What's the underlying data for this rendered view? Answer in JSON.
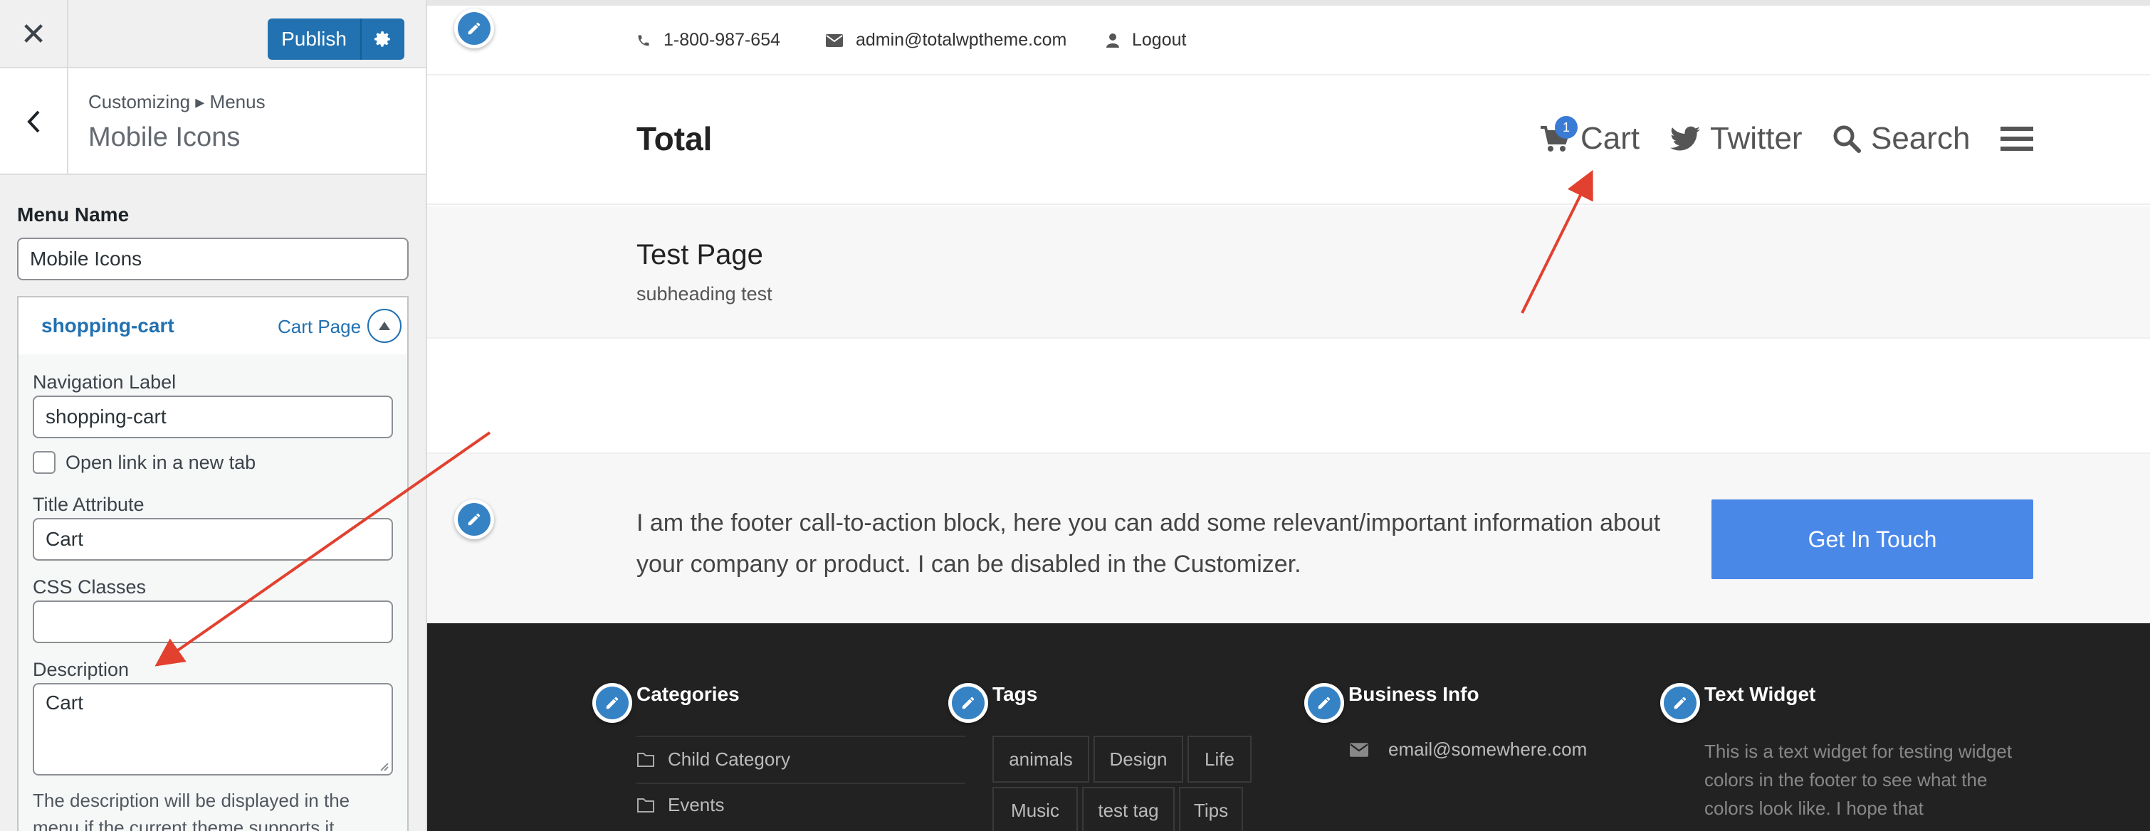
{
  "sidebar": {
    "close_label": "✕",
    "publish_label": "Publish",
    "breadcrumb": "Customizing ▸ Menus",
    "panel_title": "Mobile Icons",
    "menu_name_label": "Menu Name",
    "menu_name_value": "Mobile Icons",
    "item": {
      "title": "shopping-cart",
      "type": "Cart Page",
      "nav_label_label": "Navigation Label",
      "nav_label_value": "shopping-cart",
      "new_tab_label": "Open link in a new tab",
      "title_attr_label": "Title Attribute",
      "title_attr_value": "Cart",
      "css_classes_label": "CSS Classes",
      "css_classes_value": "",
      "description_label": "Description",
      "description_value": "Cart",
      "description_help": "The description will be displayed in the menu if the current theme supports it."
    }
  },
  "preview": {
    "topbar": {
      "phone": "1-800-987-654",
      "email": "admin@totalwptheme.com",
      "logout": "Logout"
    },
    "header": {
      "logo": "Total",
      "nav": [
        {
          "label": "Cart",
          "icon": "cart-icon",
          "badge": "1"
        },
        {
          "label": "Twitter",
          "icon": "twitter-icon"
        },
        {
          "label": "Search",
          "icon": "search-icon"
        }
      ]
    },
    "page_header": {
      "title": "Test Page",
      "subheading": "subheading test"
    },
    "cta": {
      "text": "I am the footer call-to-action block, here you can add some relevant/important information about your company or product. I can be disabled in the Customizer.",
      "button": "Get In Touch"
    },
    "footer": {
      "categories_title": "Categories",
      "categories": [
        "Child Category",
        "Events"
      ],
      "tags_title": "Tags",
      "tags": [
        "animals",
        "Design",
        "Life",
        "Music",
        "test tag",
        "Tips"
      ],
      "business_title": "Business Info",
      "business_email": "email@somewhere.com",
      "text_widget_title": "Text Widget",
      "text_widget_body": "This is a text widget for testing widget colors in the footer to see what the colors look like. I hope that"
    }
  },
  "colors": {
    "wp_blue": "#2271b1",
    "cta_blue": "#4a88e8",
    "pencil_blue": "#3582c4",
    "arrow_red": "#e2412f",
    "footer_bg": "#222222"
  }
}
